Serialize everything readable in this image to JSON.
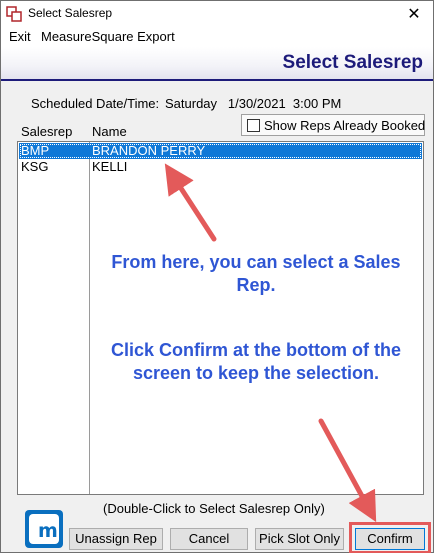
{
  "window": {
    "title": "Select Salesrep",
    "close_glyph": "✕"
  },
  "menu": {
    "exit": "Exit",
    "export": "MeasureSquare Export"
  },
  "header": {
    "title": "Select Salesrep"
  },
  "schedule": {
    "label": "Scheduled Date/Time:",
    "value": "Saturday   1/30/2021  3:00 PM"
  },
  "show_booked": {
    "label": "Show Reps Already Booked",
    "checked": false
  },
  "list": {
    "columns": [
      "Salesrep",
      "Name"
    ],
    "rows": [
      {
        "code": "BMP",
        "name": "BRANDON PERRY",
        "selected": true
      },
      {
        "code": "KSG",
        "name": "KELLI",
        "selected": false
      }
    ]
  },
  "annotations": {
    "first": "From here, you can select a Sales Rep.",
    "second": "Click Confirm at the bottom of the screen to keep the selection."
  },
  "hint": "(Double-Click to Select Salesrep Only)",
  "logo": {
    "icon": "measuresquare-logo-icon",
    "glyph": "m"
  },
  "buttons": {
    "unassign": "Unassign Rep",
    "cancel": "Cancel",
    "pick_slot": "Pick Slot Only",
    "confirm": "Confirm"
  },
  "colors": {
    "header_title": "#1d1b7a",
    "selection": "#0f78d7",
    "annotation_text": "#2f56d4",
    "annotation_arrow": "#e35a5a"
  }
}
